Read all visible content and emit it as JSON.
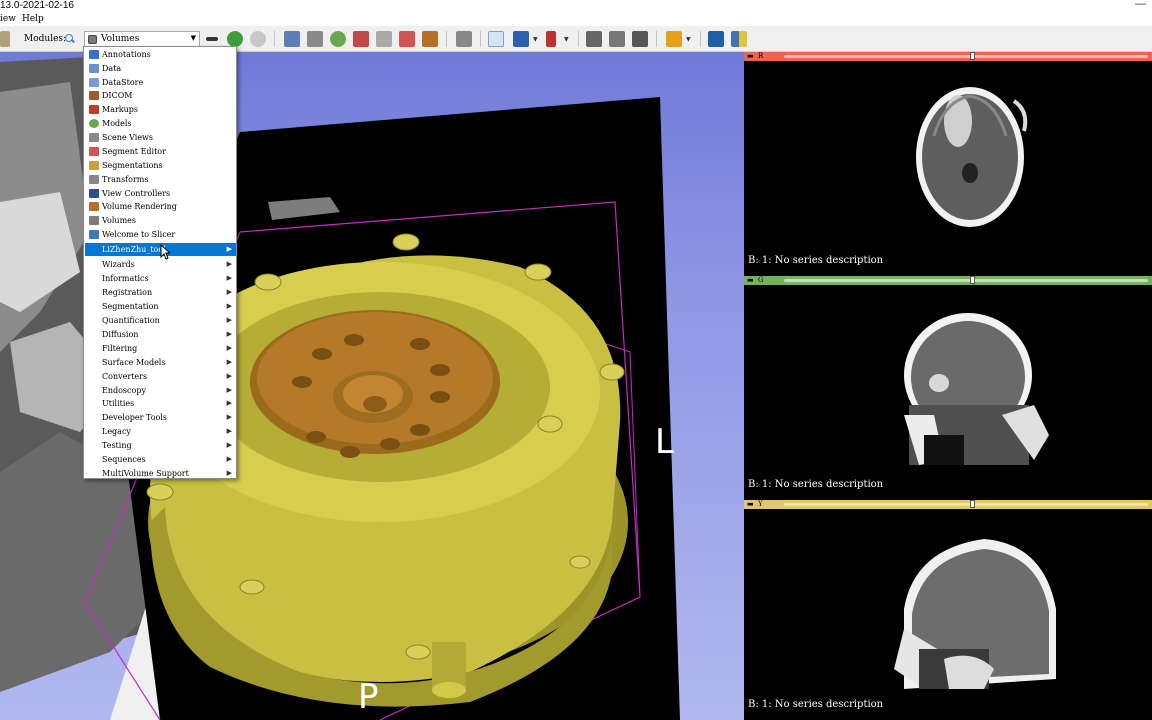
{
  "window": {
    "title": "13.0-2021-02-16"
  },
  "menubar": {
    "items": [
      "iew",
      "Help"
    ]
  },
  "toolbar": {
    "modules_label": "Modules:",
    "selected_module": "Volumes"
  },
  "module_menu": {
    "items": [
      {
        "label": "Annotations",
        "icon": "annotations-icon",
        "color": "#3a6fcf"
      },
      {
        "label": "Data",
        "icon": "data-icon",
        "color": "#6b8fd6"
      },
      {
        "label": "DataStore",
        "icon": "datastore-icon",
        "color": "#7c9cd8"
      },
      {
        "label": "DICOM",
        "icon": "dicom-icon",
        "color": "#a05a2c"
      },
      {
        "label": "Markups",
        "icon": "markups-icon",
        "color": "#c0392b"
      },
      {
        "label": "Models",
        "icon": "models-icon",
        "color": "#6aa84f"
      },
      {
        "label": "Scene Views",
        "icon": "scene-views-icon",
        "color": "#8a8a8a"
      },
      {
        "label": "Segment Editor",
        "icon": "segment-editor-icon",
        "color": "#d35454"
      },
      {
        "label": "Segmentations",
        "icon": "segmentations-icon",
        "color": "#c9a03a"
      },
      {
        "label": "Transforms",
        "icon": "transforms-icon",
        "color": "#888888"
      },
      {
        "label": "View Controllers",
        "icon": "view-controllers-icon",
        "color": "#2b4f8a"
      },
      {
        "label": "Volume Rendering",
        "icon": "volume-rendering-icon",
        "color": "#b5702a"
      },
      {
        "label": "Volumes",
        "icon": "volumes-icon",
        "color": "#7f7b78"
      },
      {
        "label": "Welcome to Slicer",
        "icon": "slicer-icon",
        "color": "#3d7ab8"
      }
    ],
    "submenus": [
      "LiZhenZhu_tool",
      "Wizards",
      "Informatics",
      "Registration",
      "Segmentation",
      "Quantification",
      "Diffusion",
      "Filtering",
      "Surface Models",
      "Converters",
      "Endoscopy",
      "Utilities",
      "Developer Tools",
      "Legacy",
      "Testing",
      "Sequences",
      "MultiVolume Support"
    ],
    "highlighted": "LiZhenZhu_tool"
  },
  "view3d": {
    "orientation_L": "L",
    "orientation_P": "P"
  },
  "slices": [
    {
      "id": "R",
      "letter": "R",
      "bar_color": "#e8664a",
      "slider": 0.62,
      "caption": "B: 1: No series description"
    },
    {
      "id": "G",
      "letter": "G",
      "bar_color": "#74b35e",
      "slider": 0.62,
      "caption": "B: 1: No series description"
    },
    {
      "id": "Y",
      "letter": "Y",
      "bar_color": "#e3c66a",
      "slider": 0.62,
      "caption": "B: 1: No series description"
    }
  ]
}
